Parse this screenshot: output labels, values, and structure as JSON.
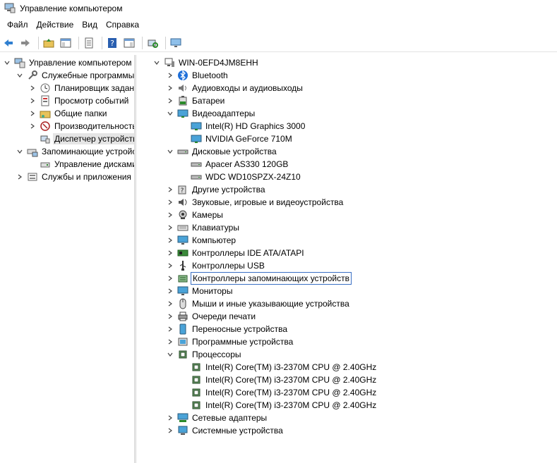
{
  "window": {
    "title": "Управление компьютером"
  },
  "menu": [
    "Файл",
    "Действие",
    "Вид",
    "Справка"
  ],
  "left_tree": [
    {
      "label": "Управление компьютером (л",
      "level": 0,
      "chev": "down",
      "icon": "computer-mgmt-icon"
    },
    {
      "label": "Служебные программы",
      "level": 1,
      "chev": "down",
      "icon": "tools-icon"
    },
    {
      "label": "Планировщик заданий",
      "level": 2,
      "chev": "right",
      "icon": "clock-icon"
    },
    {
      "label": "Просмотр событий",
      "level": 2,
      "chev": "right",
      "icon": "event-viewer-icon"
    },
    {
      "label": "Общие папки",
      "level": 2,
      "chev": "right",
      "icon": "shared-folder-icon"
    },
    {
      "label": "Производительность",
      "level": 2,
      "chev": "right",
      "icon": "performance-icon"
    },
    {
      "label": "Диспетчер устройств",
      "level": 2,
      "chev": "none",
      "icon": "device-manager-icon",
      "selected": true
    },
    {
      "label": "Запоминающие устройст",
      "level": 1,
      "chev": "down",
      "icon": "storage-icon"
    },
    {
      "label": "Управление дисками",
      "level": 2,
      "chev": "none",
      "icon": "disk-mgmt-icon"
    },
    {
      "label": "Службы и приложения",
      "level": 1,
      "chev": "right",
      "icon": "services-icon"
    }
  ],
  "device_tree": [
    {
      "label": "WIN-0EFD4JM8EHH",
      "level": 0,
      "chev": "down",
      "icon": "computer-icon"
    },
    {
      "label": "Bluetooth",
      "level": 1,
      "chev": "right",
      "icon": "bluetooth-icon"
    },
    {
      "label": "Аудиовходы и аудиовыходы",
      "level": 1,
      "chev": "right",
      "icon": "audio-io-icon"
    },
    {
      "label": "Батареи",
      "level": 1,
      "chev": "right",
      "icon": "battery-icon"
    },
    {
      "label": "Видеоадаптеры",
      "level": 1,
      "chev": "down",
      "icon": "display-adapter-icon"
    },
    {
      "label": "Intel(R) HD Graphics 3000",
      "level": 2,
      "chev": "none",
      "icon": "display-adapter-icon"
    },
    {
      "label": "NVIDIA GeForce 710M",
      "level": 2,
      "chev": "none",
      "icon": "display-adapter-icon"
    },
    {
      "label": "Дисковые устройства",
      "level": 1,
      "chev": "down",
      "icon": "disk-drive-icon"
    },
    {
      "label": "Apacer AS330 120GB",
      "level": 2,
      "chev": "none",
      "icon": "disk-drive-icon"
    },
    {
      "label": "WDC WD10SPZX-24Z10",
      "level": 2,
      "chev": "none",
      "icon": "disk-drive-icon"
    },
    {
      "label": "Другие устройства",
      "level": 1,
      "chev": "right",
      "icon": "unknown-device-icon"
    },
    {
      "label": "Звуковые, игровые и видеоустройства",
      "level": 1,
      "chev": "right",
      "icon": "sound-icon"
    },
    {
      "label": "Камеры",
      "level": 1,
      "chev": "right",
      "icon": "camera-icon"
    },
    {
      "label": "Клавиатуры",
      "level": 1,
      "chev": "right",
      "icon": "keyboard-icon"
    },
    {
      "label": "Компьютер",
      "level": 1,
      "chev": "right",
      "icon": "monitor-icon"
    },
    {
      "label": "Контроллеры IDE ATA/ATAPI",
      "level": 1,
      "chev": "right",
      "icon": "ide-controller-icon"
    },
    {
      "label": "Контроллеры USB",
      "level": 1,
      "chev": "right",
      "icon": "usb-icon"
    },
    {
      "label": "Контроллеры запоминающих устройств",
      "level": 1,
      "chev": "right",
      "icon": "storage-controller-icon",
      "focused": true
    },
    {
      "label": "Мониторы",
      "level": 1,
      "chev": "right",
      "icon": "monitor-icon"
    },
    {
      "label": "Мыши и иные указывающие устройства",
      "level": 1,
      "chev": "right",
      "icon": "mouse-icon"
    },
    {
      "label": "Очереди печати",
      "level": 1,
      "chev": "right",
      "icon": "printer-icon"
    },
    {
      "label": "Переносные устройства",
      "level": 1,
      "chev": "right",
      "icon": "portable-device-icon"
    },
    {
      "label": "Программные устройства",
      "level": 1,
      "chev": "right",
      "icon": "software-device-icon"
    },
    {
      "label": "Процессоры",
      "level": 1,
      "chev": "down",
      "icon": "processor-icon"
    },
    {
      "label": "Intel(R) Core(TM) i3-2370M CPU @ 2.40GHz",
      "level": 2,
      "chev": "none",
      "icon": "processor-icon"
    },
    {
      "label": "Intel(R) Core(TM) i3-2370M CPU @ 2.40GHz",
      "level": 2,
      "chev": "none",
      "icon": "processor-icon"
    },
    {
      "label": "Intel(R) Core(TM) i3-2370M CPU @ 2.40GHz",
      "level": 2,
      "chev": "none",
      "icon": "processor-icon"
    },
    {
      "label": "Intel(R) Core(TM) i3-2370M CPU @ 2.40GHz",
      "level": 2,
      "chev": "none",
      "icon": "processor-icon"
    },
    {
      "label": "Сетевые адаптеры",
      "level": 1,
      "chev": "right",
      "icon": "network-adapter-icon"
    },
    {
      "label": "Системные устройства",
      "level": 1,
      "chev": "right",
      "icon": "system-device-icon"
    }
  ]
}
